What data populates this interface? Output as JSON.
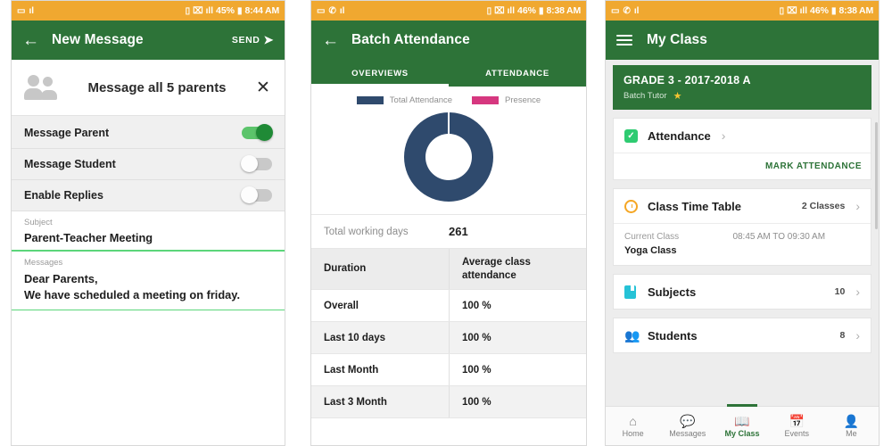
{
  "panel1": {
    "status_bar": {
      "left_icons": [
        "sim-icon",
        "signal-alt-icon"
      ],
      "vibrate_icon": "vibrate-icon",
      "wifi_icon": "wifi-icon",
      "signal_icon": "signal-icon",
      "battery_pct": "45%",
      "battery_icon": "battery-icon",
      "time": "8:44 AM"
    },
    "appbar": {
      "back": "back-arrow-icon",
      "title": "New Message",
      "send_label": "SEND",
      "send_icon": "send-arrow-icon"
    },
    "recipient": {
      "icon": "people-icon",
      "label": "Message all 5 parents",
      "close": "close-icon"
    },
    "toggles": [
      {
        "label": "Message Parent",
        "on": true
      },
      {
        "label": "Message Student",
        "on": false
      },
      {
        "label": "Enable Replies",
        "on": false
      }
    ],
    "subject": {
      "caption": "Subject",
      "value": "Parent-Teacher Meeting"
    },
    "messages": {
      "caption": "Messages",
      "line1": "Dear Parents,",
      "line2": "We have scheduled a meeting on friday."
    }
  },
  "panel2": {
    "status_bar": {
      "battery_pct": "46%",
      "time": "8:38 AM"
    },
    "appbar": {
      "back": "back-arrow-icon",
      "title": "Batch Attendance"
    },
    "tabs": [
      {
        "label": "OVERVIEWS",
        "active": true
      },
      {
        "label": "ATTENDANCE",
        "active": false
      }
    ],
    "total_working_days": {
      "label": "Total working days",
      "value": "261"
    },
    "table": {
      "headers": [
        "Duration",
        "Average class attendance"
      ],
      "rows": [
        [
          "Overall",
          "100 %"
        ],
        [
          "Last 10 days",
          "100 %"
        ],
        [
          "Last Month",
          "100 %"
        ],
        [
          "Last 3 Month",
          "100 %"
        ]
      ]
    }
  },
  "panel3": {
    "status_bar": {
      "battery_pct": "46%",
      "time": "8:38 AM"
    },
    "appbar": {
      "menu": "hamburger-icon",
      "title": "My Class"
    },
    "class_banner": {
      "title": "GRADE 3 - 2017-2018 A",
      "subtitle": "Batch Tutor",
      "star": "star-icon"
    },
    "attendance_card": {
      "icon": "checkbox-icon",
      "title": "Attendance",
      "chevron": "chevron-right-icon",
      "action": "MARK ATTENDANCE"
    },
    "timetable_card": {
      "icon": "alarm-clock-icon",
      "title": "Class Time Table",
      "meta": "2 Classes",
      "chevron": "chevron-right-icon",
      "current_label": "Current Class",
      "current_time": "08:45 AM TO 09:30 AM",
      "current_name": "Yoga Class"
    },
    "subjects_card": {
      "icon": "book-icon",
      "title": "Subjects",
      "meta": "10",
      "chevron": "chevron-right-icon"
    },
    "students_card": {
      "icon": "students-icon",
      "title": "Students",
      "meta": "8",
      "chevron": "chevron-right-icon"
    },
    "bottom_nav": [
      {
        "label": "Home",
        "icon": "home-icon",
        "glyph": "⌂",
        "active": false
      },
      {
        "label": "Messages",
        "icon": "chat-icon",
        "glyph": "▬",
        "active": false
      },
      {
        "label": "My Class",
        "icon": "book-open-icon",
        "glyph": "□",
        "active": true
      },
      {
        "label": "Events",
        "icon": "calendar-icon",
        "glyph": "▦",
        "active": false
      },
      {
        "label": "Me",
        "icon": "person-icon",
        "glyph": "●",
        "active": false
      }
    ]
  },
  "colors": {
    "appbar_green": "#2d7338",
    "status_orange": "#f0a830",
    "toggle_on": "#1f8a36",
    "donut_navy": "#2f4a6d",
    "legend_pink": "#d6377f",
    "accent_underline": "#5bd67a"
  },
  "chart_data": {
    "type": "pie",
    "title": "",
    "labels": [
      "Total Attendance",
      "Presence"
    ],
    "values": [
      100,
      0
    ],
    "colors": [
      "#2f4a6d",
      "#d6377f"
    ],
    "legend_position": "top",
    "donut": true,
    "note": "Donut chart fully filled by Total Attendance; Presence slice not visible"
  }
}
